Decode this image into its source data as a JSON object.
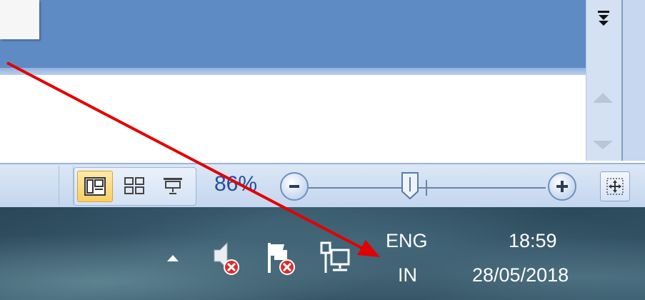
{
  "document_view": {},
  "status_bar": {
    "view_buttons": [
      {
        "name": "normal-view",
        "active": true
      },
      {
        "name": "slide-sorter-view",
        "active": false
      },
      {
        "name": "reading-view",
        "active": false
      }
    ],
    "zoom_label": "86%",
    "zoom_level_percent": 86
  },
  "taskbar": {
    "language": {
      "top": "ENG",
      "bottom": "IN"
    },
    "clock": {
      "time": "18:59",
      "date": "28/05/2018"
    },
    "tray_icons": [
      "show-hidden-icons-chevron",
      "volume-muted-icon",
      "action-center-flag-icon",
      "network-disconnected-icon"
    ]
  },
  "colors": {
    "pane_blue": "#5f8bc5",
    "annotation_arrow": "#e30000",
    "zoom_text": "#264fa0",
    "tray_error_red": "#d92c2c"
  }
}
